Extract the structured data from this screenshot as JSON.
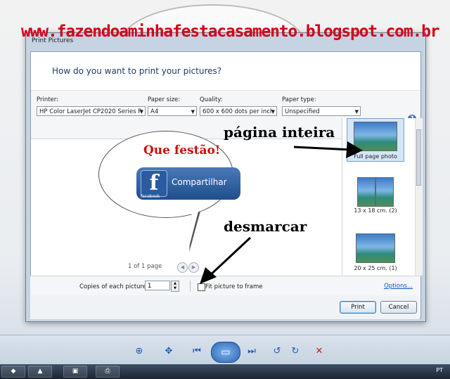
{
  "watermark": "www.fazendoaminhafestacasamento.blogspot.com.br",
  "dialog": {
    "title": "Print Pictures",
    "heading": "How do you want to print your pictures?",
    "options": [
      {
        "label": "Printer:",
        "value": "HP Color LaserJet CP2020 Series P"
      },
      {
        "label": "Paper size:",
        "value": "A4"
      },
      {
        "label": "Quality:",
        "value": "600 x 600 dots per inch"
      },
      {
        "label": "Paper type:",
        "value": "Unspecified"
      }
    ],
    "help_icon": "?",
    "preview": {
      "headline": "Que festão!",
      "share_label": "Compartilhar",
      "fb_small": "facebook",
      "fb_logo": "f"
    },
    "pager": "1 of 1 page",
    "layouts": [
      {
        "label": "Full page photo"
      },
      {
        "label": "13 x 18 cm. (2)"
      },
      {
        "label": "20 x 25 cm. (1)"
      }
    ],
    "copies_label": "Copies of each picture:",
    "copies_value": "1",
    "fit_label": "Fit picture to frame",
    "options_link": "Options...",
    "print_label": "Print",
    "cancel_label": "Cancel"
  },
  "annotations": {
    "full_page": "página inteira",
    "uncheck": "desmarcar"
  },
  "taskbar": {
    "lang": "PT"
  },
  "icons": [
    "zoom-icon",
    "fit-icon",
    "prev-icon",
    "slideshow-icon",
    "next-icon",
    "rotate-ccw-icon",
    "rotate-cw-icon",
    "delete-icon",
    "chevron-down-icon",
    "checkbox-icon"
  ]
}
